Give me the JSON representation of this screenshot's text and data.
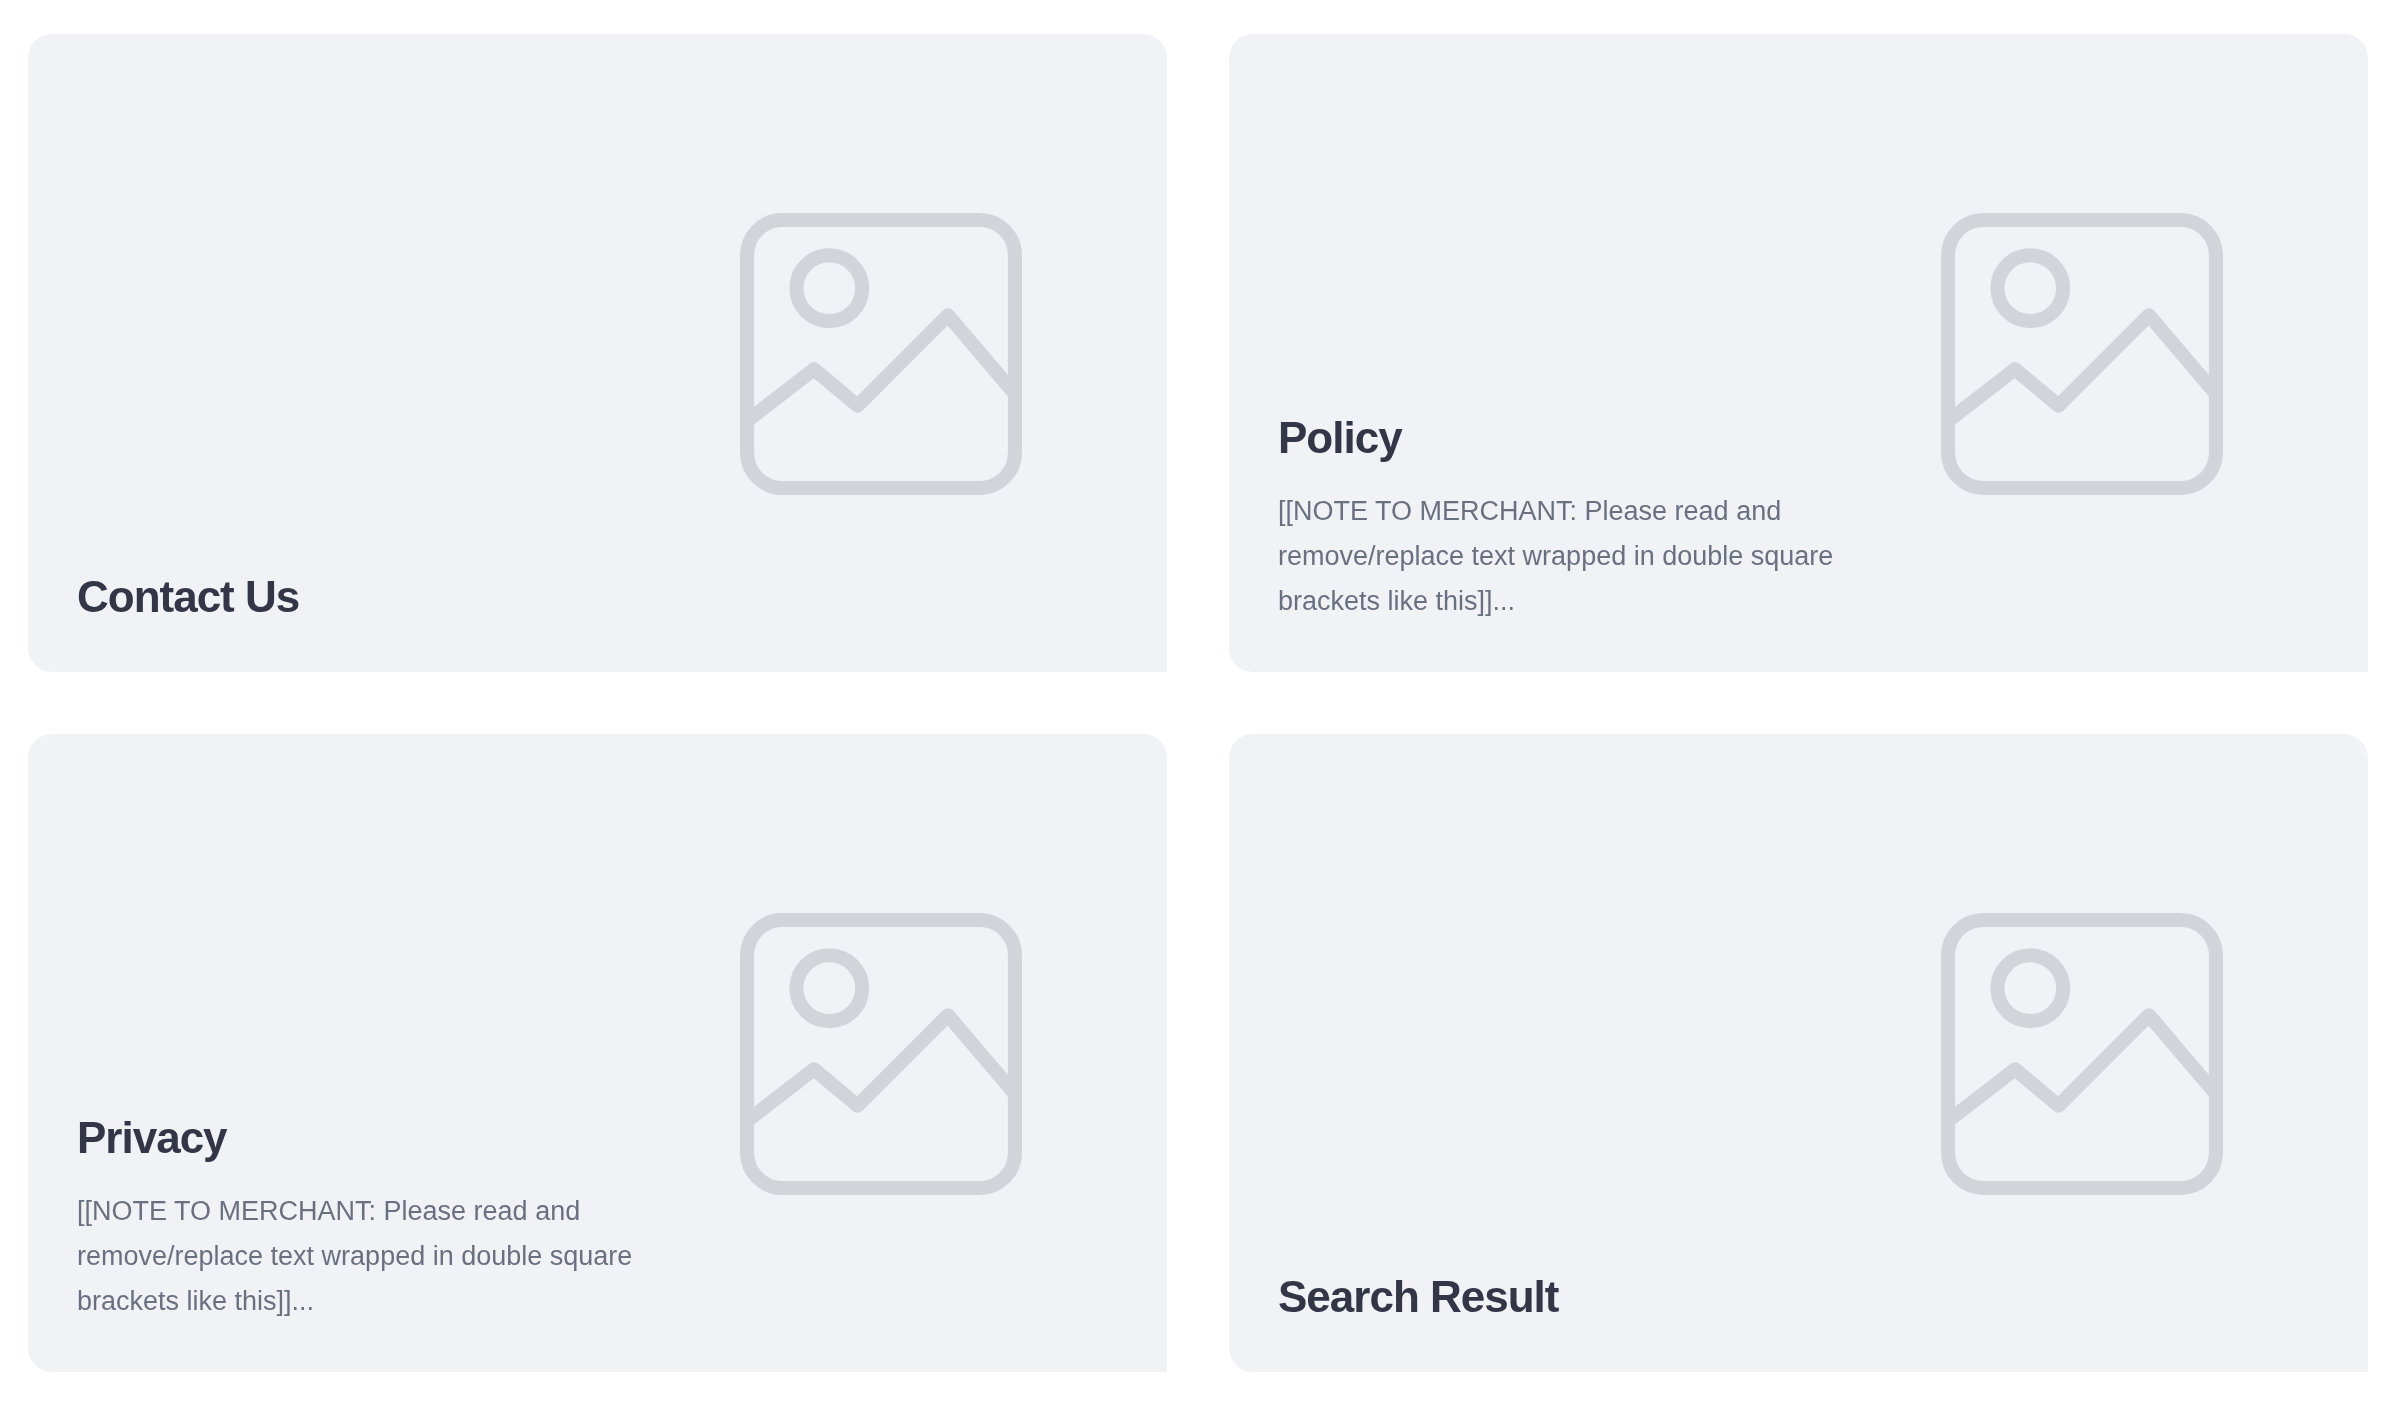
{
  "cards": [
    {
      "title": "Contact Us"
    },
    {
      "title": "Policy",
      "description": "[[NOTE TO MERCHANT: Please read and remove/replace text wrapped in double square brackets like this]]..."
    },
    {
      "title": "Privacy",
      "description": "[[NOTE TO MERCHANT: Please read and remove/replace text wrapped in double square brackets like this]]..."
    },
    {
      "title": "Search Result"
    }
  ]
}
